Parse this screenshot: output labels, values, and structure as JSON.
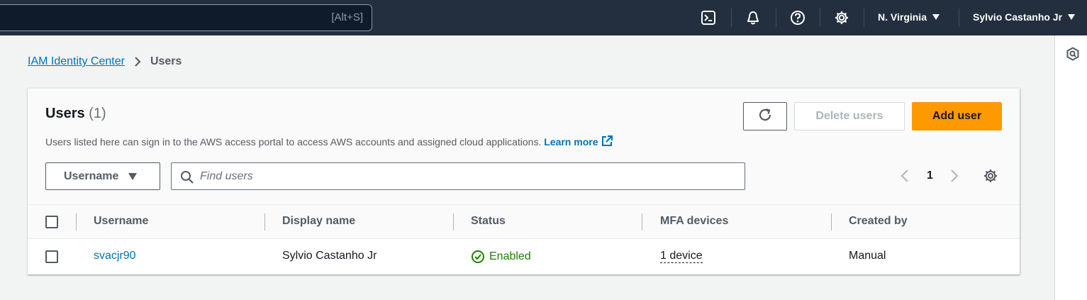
{
  "topnav": {
    "search_shortcut": "[Alt+S]",
    "icons": [
      "cloudshell-icon",
      "notifications-bell-icon",
      "help-icon",
      "settings-gear-icon"
    ],
    "region": "N. Virginia",
    "user": "Sylvio Castanho Jr"
  },
  "rail": {
    "icon": "feedback-hex-icon"
  },
  "breadcrumb": {
    "items": [
      "IAM Identity Center",
      "Users"
    ]
  },
  "panel": {
    "title": "Users",
    "count": "(1)",
    "description": "Users listed here can sign in to the AWS access portal to access AWS accounts and assigned cloud applications.",
    "learn_more": "Learn more",
    "buttons": {
      "delete": "Delete users",
      "add": "Add user"
    },
    "filter": {
      "property": "Username",
      "search_placeholder": "Find users"
    },
    "pagination": {
      "current_page": "1"
    }
  },
  "table": {
    "columns": [
      "Username",
      "Display name",
      "Status",
      "MFA devices",
      "Created by"
    ],
    "rows": [
      {
        "username": "svacjr90",
        "display_name": "Sylvio Castanho Jr",
        "status": "Enabled",
        "mfa": "1 device",
        "created_by": "Manual"
      }
    ]
  },
  "colors": {
    "nav_bg": "#232f3e",
    "accent_orange": "#ff9900",
    "link_blue": "#0073bb",
    "success_green": "#1d8102"
  }
}
